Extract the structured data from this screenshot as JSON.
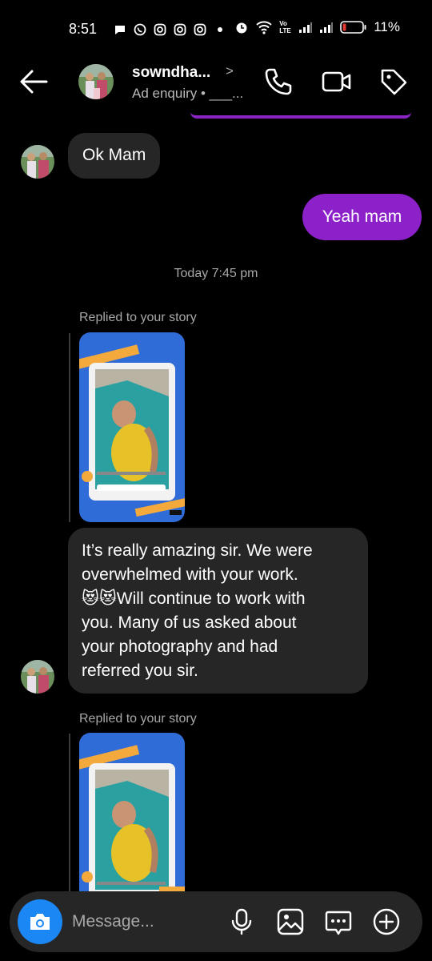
{
  "status_bar": {
    "time": "8:51",
    "battery": "11%",
    "network_label": "Vo LTE",
    "icons": [
      "chat-bubble-icon",
      "whatsapp-icon",
      "instagram-icon",
      "instagram-icon",
      "instagram-icon",
      "dot-icon",
      "alarm-icon",
      "wifi-icon",
      "volte-icon",
      "signal-icon",
      "signal-icon",
      "battery-icon"
    ]
  },
  "header": {
    "name": "sowndha...",
    "chevron": ">",
    "subtitle": "Ad enquiry • ___...",
    "icons": [
      "back-arrow-icon",
      "phone-icon",
      "video-icon",
      "tag-icon"
    ]
  },
  "thread": {
    "msg_ok_mam": "Ok Mam",
    "msg_yeah_mam": "Yeah mam",
    "date_divider": "Today 7:45 pm",
    "replied_label_1": "Replied to your story",
    "msg_amazing_line1": "It’s really amazing sir. We were",
    "msg_amazing_line2": "overwhelmed with your work.",
    "msg_amazing_line3": "Will continue to work with",
    "msg_amazing_line4": "you. Many of us asked about",
    "msg_amazing_line5": "your photography and had",
    "msg_amazing_line6": "referred you sir.",
    "emoji": "😻😻",
    "replied_label_2": "Replied to your story"
  },
  "composer": {
    "placeholder": "Message...",
    "icons": [
      "camera-icon",
      "microphone-icon",
      "gallery-icon",
      "sticker-icon",
      "plus-icon"
    ]
  },
  "colors": {
    "outgoing_bubble": "#8c21c9",
    "incoming_bubble": "#262626",
    "camera_button": "#1b87f5",
    "story_card": "#2f6cd8",
    "story_tape": "#f4a93c"
  }
}
